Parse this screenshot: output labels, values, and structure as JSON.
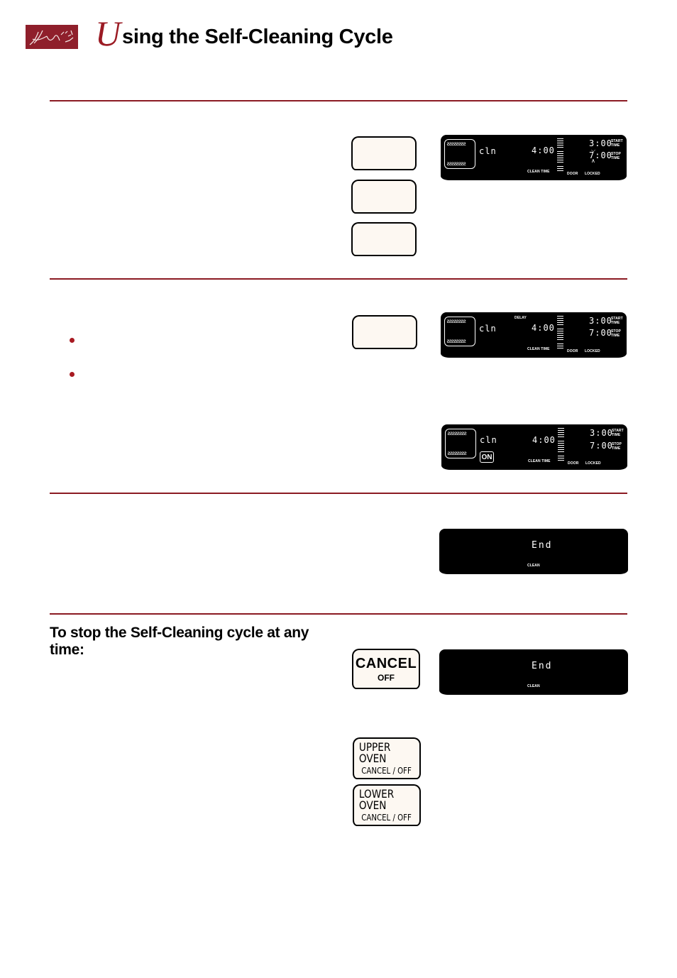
{
  "header": {
    "logo_icon": "decorative-logo",
    "title_initial": "U",
    "title_rest": "sing the Self-Cleaning Cycle"
  },
  "colors": {
    "accent": "#8b1a22",
    "display_bg": "#000000",
    "button_bg": "#fdf8f2"
  },
  "section1": {
    "buttons": [
      "",
      "",
      ""
    ],
    "display": {
      "mode": "cln",
      "time": "4:00",
      "clean_time_label": "CLEAN TIME",
      "start_time": "3:00",
      "start_label_1": "START",
      "start_label_2": "TIME",
      "stop_time": "7:00",
      "stop_label_1": "STOP",
      "stop_label_2": "TIME",
      "door_label": "DOOR",
      "locked_label": "LOCKED",
      "stop_flashing": true
    }
  },
  "section2": {
    "buttons": [
      ""
    ],
    "display_delay": {
      "delay_label": "DELAY",
      "mode": "cln",
      "time": "4:00",
      "clean_time_label": "CLEAN TIME",
      "start_time": "3:00",
      "start_label_1": "START",
      "start_label_2": "TIME",
      "stop_time": "7:00",
      "stop_label_1": "STOP",
      "stop_label_2": "TIME",
      "door_label": "DOOR",
      "locked_label": "LOCKED"
    },
    "display_on": {
      "mode": "cln",
      "on_badge": "ON",
      "time": "4:00",
      "clean_time_label": "CLEAN TIME",
      "start_time": "3:00",
      "start_label_1": "START",
      "start_label_2": "TIME",
      "stop_time": "7:00",
      "stop_label_1": "STOP",
      "stop_label_2": "TIME",
      "door_label": "DOOR",
      "locked_label": "LOCKED"
    }
  },
  "section3": {
    "display": {
      "text": "End",
      "label": "CLEAN"
    }
  },
  "section4": {
    "heading": "To stop the Self-Cleaning cycle at any time:",
    "cancel_button": {
      "label": "CANCEL",
      "sub": "OFF"
    },
    "display": {
      "text": "End",
      "label": "CLEAN"
    },
    "upper_button": {
      "label": "UPPER OVEN",
      "sub": "CANCEL / OFF"
    },
    "lower_button": {
      "label": "LOWER OVEN",
      "sub": "CANCEL / OFF"
    }
  }
}
